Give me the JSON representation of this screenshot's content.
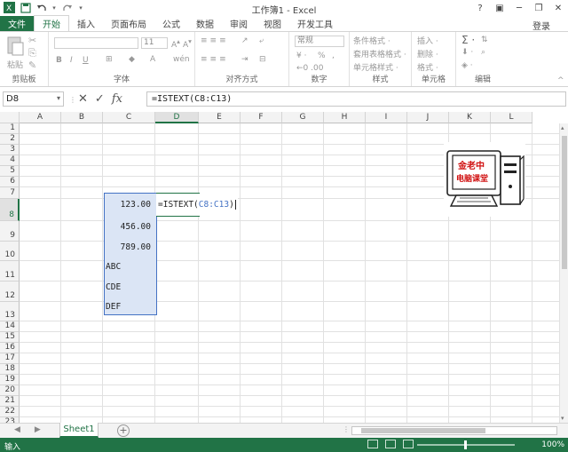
{
  "window": {
    "title": "工作簿1 - Excel",
    "sign_in": "登录"
  },
  "tabs": [
    {
      "label": "文件"
    },
    {
      "label": "开始"
    },
    {
      "label": "插入"
    },
    {
      "label": "页面布局"
    },
    {
      "label": "公式"
    },
    {
      "label": "数据"
    },
    {
      "label": "审阅"
    },
    {
      "label": "视图"
    },
    {
      "label": "开发工具"
    }
  ],
  "ribbon": {
    "clipboard": {
      "label": "剪贴板",
      "paste": "粘贴"
    },
    "font": {
      "label": "字体",
      "size": "11"
    },
    "alignment": {
      "label": "对齐方式"
    },
    "number": {
      "label": "数字",
      "format": "常规"
    },
    "styles": {
      "label": "样式",
      "items": [
        "条件格式 ·",
        "套用表格格式 ·",
        "单元格样式 ·"
      ]
    },
    "cells": {
      "label": "单元格",
      "items": [
        "插入 ·",
        "删除 ·",
        "格式 ·"
      ]
    },
    "editing": {
      "label": "编辑"
    }
  },
  "formula_bar": {
    "name_box": "D8",
    "formula": "=ISTEXT(C8:C13)"
  },
  "columns": [
    "A",
    "B",
    "C",
    "D",
    "E",
    "F",
    "G",
    "H",
    "I",
    "J",
    "K",
    "L"
  ],
  "rows": [
    "1",
    "2",
    "3",
    "4",
    "5",
    "6",
    "7",
    "8",
    "9",
    "10",
    "11",
    "12",
    "13",
    "14",
    "15",
    "16",
    "17",
    "18",
    "19",
    "20",
    "21",
    "22",
    "23"
  ],
  "cells": {
    "C8": "123.00",
    "C9": "456.00",
    "C10": "789.00",
    "C11": "ABC",
    "C12": "CDE",
    "C13": "DEF",
    "D8_prefix": "=ISTEXT(",
    "D8_ref": "C8:C13",
    "D8_suffix": ")"
  },
  "logo": {
    "line1": "金老中",
    "line2": "电脑课堂"
  },
  "sheets": [
    {
      "name": "Sheet1"
    }
  ],
  "status": {
    "mode": "输入",
    "zoom": "100%"
  },
  "colors": {
    "accent": "#217346",
    "range_fill": "#dbe5f5",
    "range_border": "#4472c4"
  }
}
